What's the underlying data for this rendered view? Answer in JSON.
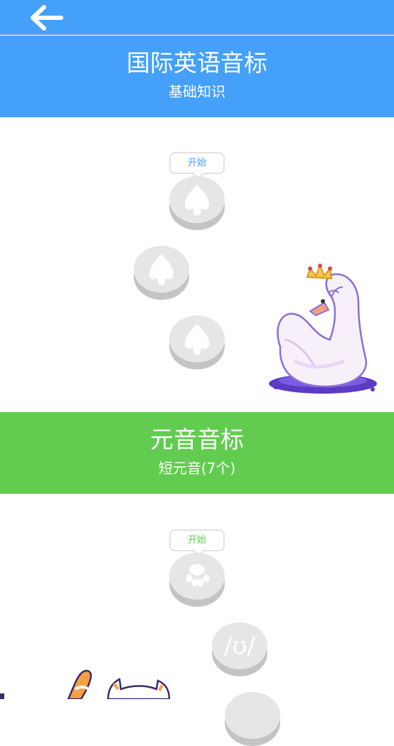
{
  "header": {
    "back_icon": "arrow-left-icon"
  },
  "sections": [
    {
      "title": "国际英语音标",
      "subtitle": "基础知识",
      "color": "#44a0f8",
      "start_label": "开始",
      "nodes": [
        {
          "icon": "leaf-icon"
        },
        {
          "icon": "leaf-icon"
        },
        {
          "icon": "leaf-icon"
        }
      ],
      "mascot": "swan-illustration"
    },
    {
      "title": "元音音标",
      "subtitle": "短元音(7个)",
      "color": "#62cc50",
      "start_label": "开始",
      "nodes": [
        {
          "icon": "paw-icon"
        },
        {
          "symbol": "/ʊ/"
        }
      ],
      "mascot": "cat-illustration"
    }
  ]
}
